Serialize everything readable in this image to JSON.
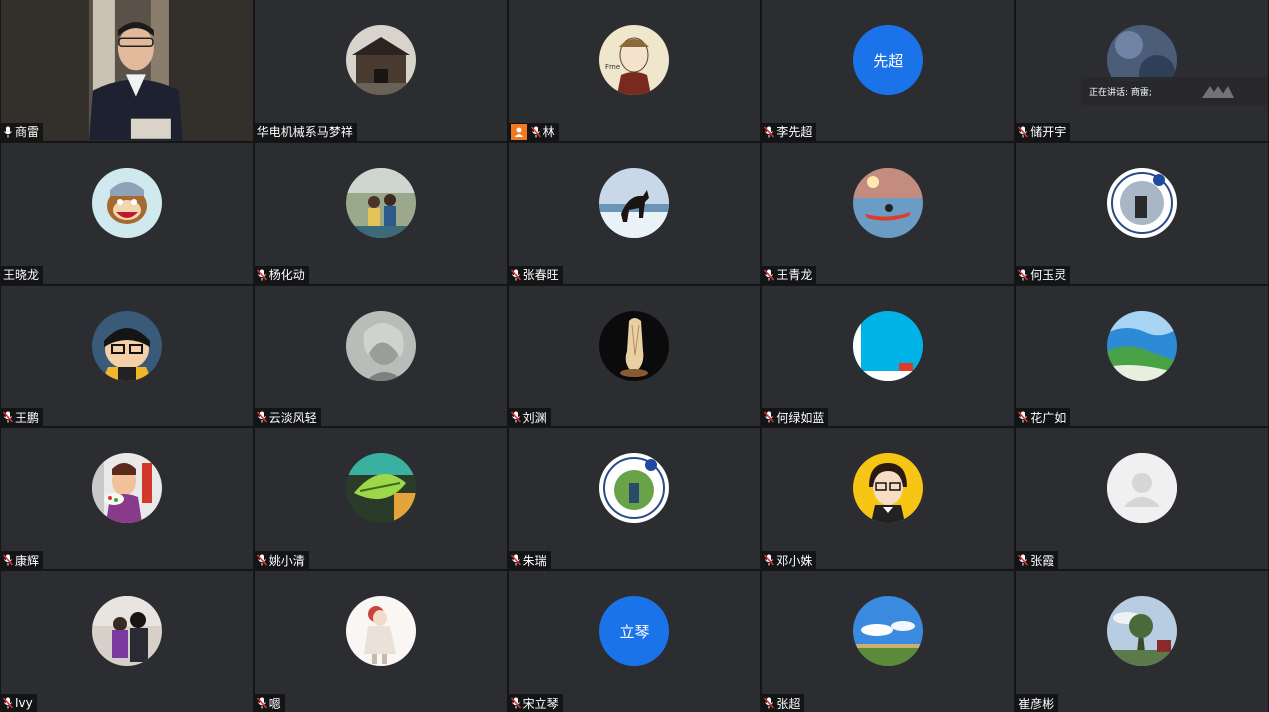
{
  "speaking_banner": "正在讲话: 商雷;",
  "participants": [
    {
      "name": "商雷",
      "avatar": "video",
      "mic": "on",
      "active": true
    },
    {
      "name": "华电机械系马梦祥",
      "avatar": "photo-gate",
      "mic": "none"
    },
    {
      "name": "林",
      "avatar": "photo-sketch",
      "mic": "muted",
      "host": true
    },
    {
      "name": "李先超",
      "avatar": "text",
      "avatar_text": "先超",
      "mic": "muted"
    },
    {
      "name": "储开宇",
      "avatar": "photo-night",
      "mic": "muted"
    },
    {
      "name": "王晓龙",
      "avatar": "photo-monkey",
      "mic": "none"
    },
    {
      "name": "杨化动",
      "avatar": "photo-couple",
      "mic": "muted"
    },
    {
      "name": "张春旺",
      "avatar": "photo-horse",
      "mic": "muted"
    },
    {
      "name": "王青龙",
      "avatar": "photo-kayak",
      "mic": "muted"
    },
    {
      "name": "何玉灵",
      "avatar": "photo-logo",
      "mic": "muted"
    },
    {
      "name": "王鹏",
      "avatar": "photo-cartoon",
      "mic": "muted"
    },
    {
      "name": "云淡风轻",
      "avatar": "photo-portrait",
      "mic": "muted"
    },
    {
      "name": "刘渊",
      "avatar": "photo-vase",
      "mic": "muted"
    },
    {
      "name": "何绿如蓝",
      "avatar": "photo-cyan",
      "mic": "muted"
    },
    {
      "name": "花广如",
      "avatar": "photo-coast",
      "mic": "muted"
    },
    {
      "name": "康辉",
      "avatar": "photo-painter",
      "mic": "muted"
    },
    {
      "name": "姚小清",
      "avatar": "photo-leaf",
      "mic": "muted"
    },
    {
      "name": "朱瑞",
      "avatar": "photo-logo2",
      "mic": "muted"
    },
    {
      "name": "邓小姝",
      "avatar": "photo-girl",
      "mic": "muted"
    },
    {
      "name": "张霞",
      "avatar": "placeholder",
      "mic": "muted"
    },
    {
      "name": "Ivy",
      "avatar": "photo-family",
      "mic": "muted"
    },
    {
      "name": "嗯",
      "avatar": "photo-doll",
      "mic": "muted"
    },
    {
      "name": "宋立琴",
      "avatar": "text",
      "avatar_text": "立琴",
      "mic": "muted"
    },
    {
      "name": "张超",
      "avatar": "photo-sky",
      "mic": "muted"
    },
    {
      "name": "崔彦彬",
      "avatar": "photo-park",
      "mic": "none"
    }
  ],
  "colors": {
    "tile_bg": "#2b2d31",
    "active_border": "#1fa34a",
    "text_avatar_bg": "#1a73e8",
    "host_badge": "#f07a22",
    "muted_mic": "#e03131"
  }
}
